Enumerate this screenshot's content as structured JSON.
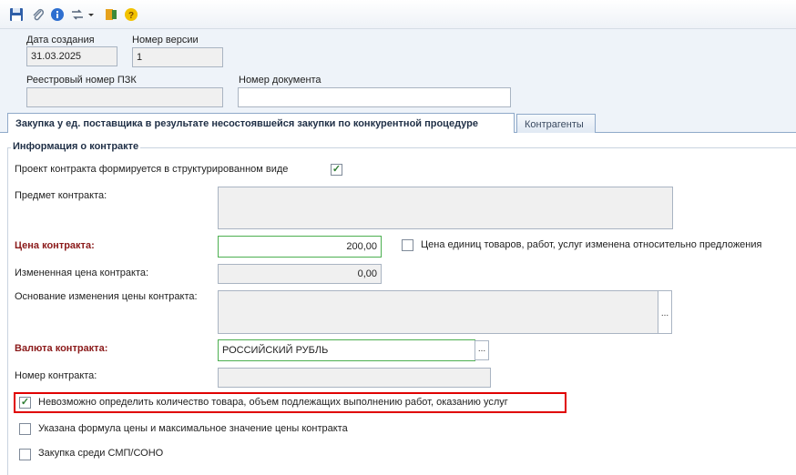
{
  "toolbar": {
    "icons": [
      "save-icon",
      "attach-icon",
      "info-icon",
      "workflow-icon",
      "exit-icon",
      "help-icon"
    ]
  },
  "header": {
    "creation_date_label": "Дата создания",
    "creation_date_value": "31.03.2025",
    "version_label": "Номер версии",
    "version_value": "1",
    "registry_label": "Реестровый номер ПЗК",
    "registry_value": "",
    "document_label": "Номер документа",
    "document_value": ""
  },
  "tabs": [
    {
      "label": "Закупка у ед. поставщика в результате несостоявшейся закупки по конкурентной процедуре",
      "active": true
    },
    {
      "label": "Контрагенты",
      "active": false
    }
  ],
  "contract": {
    "group_title": "Информация о контракте",
    "structured_label": "Проект контракта формируется в структурированном виде",
    "structured_checked": true,
    "subject_label": "Предмет контракта:",
    "subject_value": "",
    "price_label": "Цена контракта:",
    "price_value": "200,00",
    "unit_price_changed_label": "Цена единиц товаров, работ, услуг изменена относительно предложения",
    "unit_price_changed_checked": false,
    "changed_price_label": "Измененная цена контракта:",
    "changed_price_value": "0,00",
    "change_basis_label": "Основание изменения цены контракта:",
    "change_basis_value": "",
    "currency_label": "Валюта контракта:",
    "currency_value": "РОССИЙСКИЙ РУБЛЬ",
    "number_label": "Номер контракта:",
    "number_value": "",
    "impossible_qty_label": "Невозможно определить количество товара, объем подлежащих выполнению работ, оказанию услуг",
    "impossible_qty_checked": true,
    "formula_label": "Указана формула цены и максимальное значение цены контракта",
    "formula_checked": false,
    "smp_label": "Закупка среди СМП/СОНО",
    "smp_checked": false,
    "ellipsis": "...",
    "check_mark": "✓"
  },
  "colors": {
    "accent_border": "#8fa9c9",
    "required_label": "#8b1a1a",
    "highlight": "#e00000",
    "valid_field_border": "#4caf50"
  }
}
